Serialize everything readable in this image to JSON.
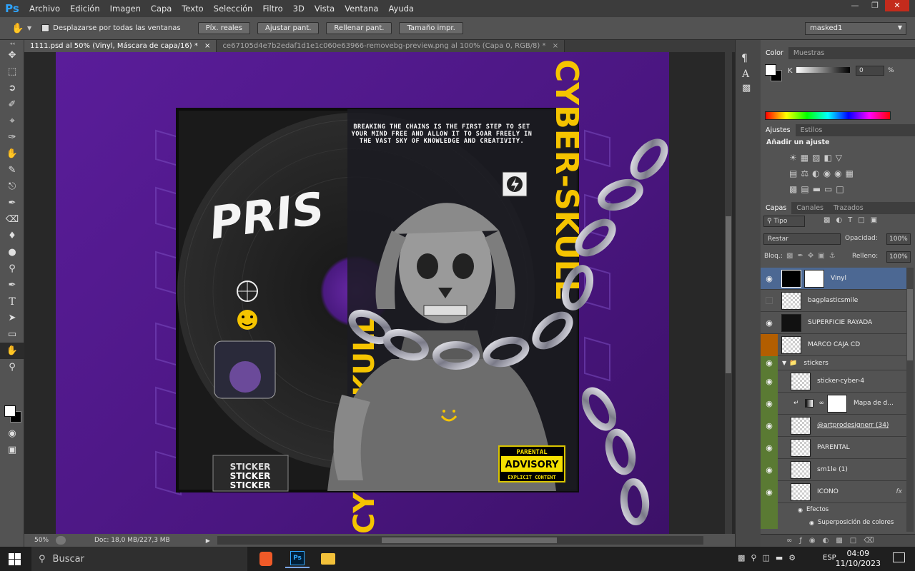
{
  "app": {
    "logo": "Ps"
  },
  "menu": [
    "Archivo",
    "Edición",
    "Imagen",
    "Capa",
    "Texto",
    "Selección",
    "Filtro",
    "3D",
    "Vista",
    "Ventana",
    "Ayuda"
  ],
  "options_bar": {
    "scroll_all_label": "Desplazarse por todas las ventanas",
    "buttons": [
      "Píx. reales",
      "Ajustar pant.",
      "Rellenar pant.",
      "Tamaño impr."
    ],
    "workspace": "masked1"
  },
  "tabs": [
    {
      "label": "1111.psd al 50% (Vinyl, Máscara de capa/16) *",
      "close": "×"
    },
    {
      "label": "ce67105d4e7b2edaf1d1e1c060e63966-removebg-preview.png al 100% (Capa 0, RGB/8) *",
      "close": "×"
    }
  ],
  "artwork": {
    "quote": "BREAKING THE CHAINS IS THE FIRST STEP TO SET YOUR MIND FREE AND ALLOW IT TO SOAR FREELY IN THE VAST SKY OF KNOWLEDGE AND CREATIVITY.",
    "vinyl_title": "PRIS",
    "vertical_title": "CYBER-SKULL",
    "sticker_text": "STICKER",
    "advisory_top": "PARENTAL",
    "advisory_mid": "ADVISORY",
    "advisory_bottom": "EXPLICIT CONTENT"
  },
  "status": {
    "zoom": "50%",
    "doc": "Doc: 18,0 MB/227,3 MB"
  },
  "color_panel": {
    "tabs": [
      "Color",
      "Muestras"
    ],
    "channel": "K",
    "value": "0",
    "unit": "%"
  },
  "adjust_panel": {
    "tabs": [
      "Ajustes",
      "Estilos"
    ],
    "title": "Añadir un ajuste"
  },
  "layers_panel": {
    "tabs": [
      "Capas",
      "Canales",
      "Trazados"
    ],
    "filter": "Tipo",
    "blend_mode": "Restar",
    "opacity_label": "Opacidad:",
    "opacity": "100%",
    "lock_label": "Bloq.:",
    "fill_label": "Relleno:",
    "fill": "100%",
    "layers": [
      {
        "name": "Vinyl",
        "selected": true
      },
      {
        "name": "bagplasticsmile"
      },
      {
        "name": "SUPERFICIE RAYADA"
      },
      {
        "name": "MARCO CAJA CD"
      },
      {
        "name": "stickers"
      },
      {
        "name": "sticker-cyber-4"
      },
      {
        "name": "Mapa de d..."
      },
      {
        "name": "@artprodesignerr (34)"
      },
      {
        "name": "PARENTAL"
      },
      {
        "name": "sm1le (1)"
      },
      {
        "name": "ICONO"
      }
    ],
    "effects_label": "Efectos",
    "effect_name": "Superposición de colores",
    "fx": "fx"
  },
  "taskbar": {
    "search_placeholder": "Buscar",
    "lang": "ESP",
    "time": "04:09",
    "date": "11/10/2023"
  }
}
